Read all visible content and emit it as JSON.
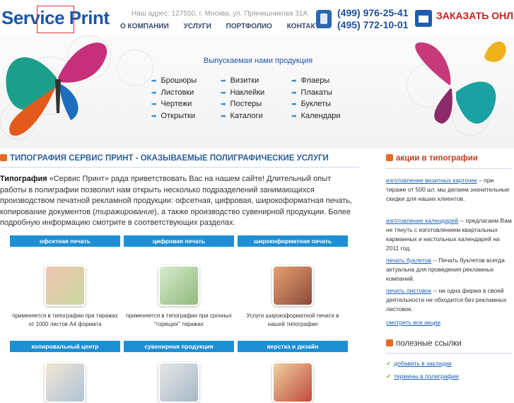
{
  "header": {
    "logo_service": "Service",
    "logo_print": "Print",
    "address": "Наш адрес: 127550, г. Москва, ул. Прянишникова 31А",
    "nav": [
      "О КОМПАНИИ",
      "УСЛУГИ",
      "ПОРТФОЛИО",
      "КОНТАКТЫ"
    ],
    "phone1": "(499) 976-25-41",
    "phone2": "(495) 772-10-01",
    "order_label": "ЗАКАЗАТЬ ОНЛАЙН"
  },
  "banner": {
    "title": "Выпускаемая нами продукция",
    "col1": [
      "Брошюры",
      "Листовки",
      "Чертежи",
      "Открытки"
    ],
    "col2": [
      "Визитки",
      "Наклейки",
      "Постеры",
      "Каталоги"
    ],
    "col3": [
      "Флаеры",
      "Плакаты",
      "Буклеты",
      "Календари"
    ]
  },
  "main": {
    "title": "ТИПОГРАФИЯ СЕРВИС ПРИНТ - ОКАЗЫВАЕМЫЕ ПОЛИГРАФИЧЕСКИЕ УСЛУГИ",
    "intro_bold": "Типография",
    "intro_1": " «Сервис Принт» рада приветствовать Вас на нашем сайте! Длительный опыт работы в полиграфии позволил нам открыть несколько подразделений занимающихся производством печатной рекламной продукции: офсетная, цифровая, широкоформатная печать, копирование документов  (",
    "intro_em": "тиражирование",
    "intro_2": "), а также производство сувенирной продукции. Более подробную информацию смотрите в соответствующих разделах.",
    "categories": [
      {
        "label": "офсетная печать",
        "text": "применяется в типографии при тиражах от 1000 листов А4 формата"
      },
      {
        "label": "цифровая печать",
        "text": "применяется в типографии при срочных \"горящих\" тиражах"
      },
      {
        "label": "широкоформатная печать",
        "text": "Услуги широкоформатной печати в нашей типографии"
      },
      {
        "label": "копировальный центр",
        "text": ""
      },
      {
        "label": "сувенирная продукция",
        "text": ""
      },
      {
        "label": "верстка и дизайн",
        "text": ""
      }
    ]
  },
  "sidebar": {
    "promo_title": "акции в типографии",
    "promos": [
      {
        "link": "изготовление визитных карточек",
        "text": " – при тираже от 500 шт. мы делаем значительные скидки для наших клиентов."
      },
      {
        "link": "изготовление календарей",
        "text": " -- предлагаем Вам не тянуть с изготовлением квартальных карманных и настольных календарей на 2011 год."
      },
      {
        "link": "печать буклетов",
        "text": " -- Печать буклетов всегда актуальна для проведения рекламных компаний."
      },
      {
        "link": "печать листовок",
        "text": " -- ни одна фирма в своей деятельности не обходится без рекламных листовок."
      }
    ],
    "all_promos": "смотреть все акции",
    "links_title": "полезные ссылки",
    "links": [
      "добавить в закладки",
      "термины в полиграфии"
    ]
  }
}
